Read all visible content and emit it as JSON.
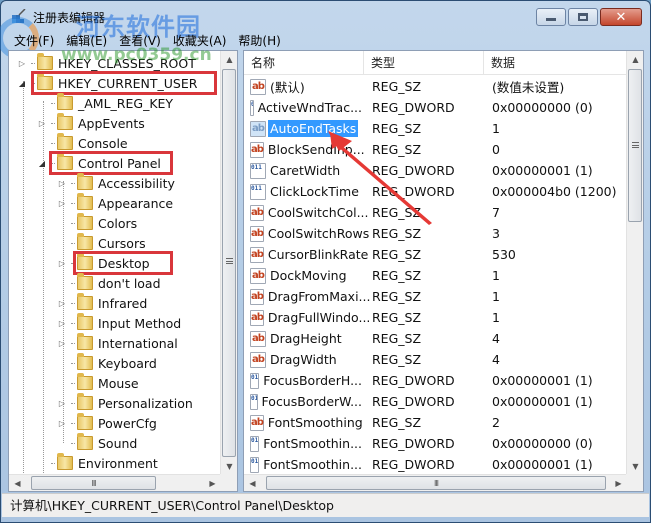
{
  "window": {
    "title": "注册表编辑器",
    "buttons": {
      "minimize": "minimize",
      "maximize": "maximize",
      "close": "✕"
    }
  },
  "watermark": {
    "text": "河东软件园",
    "url": "www.pc0359.cn"
  },
  "menu": [
    {
      "label": "文件(F)"
    },
    {
      "label": "编辑(E)"
    },
    {
      "label": "查看(V)"
    },
    {
      "label": "收藏夹(A)"
    },
    {
      "label": "帮助(H)"
    }
  ],
  "tree": {
    "items": [
      {
        "label": "HKEY_CLASSES_ROOT",
        "level": 0,
        "expander": "▷",
        "highlighted": false
      },
      {
        "label": "HKEY_CURRENT_USER",
        "level": 0,
        "expander": "◢",
        "highlighted": true
      },
      {
        "label": "_AML_REG_KEY",
        "level": 1,
        "expander": "",
        "highlighted": false
      },
      {
        "label": "AppEvents",
        "level": 1,
        "expander": "▷",
        "highlighted": false
      },
      {
        "label": "Console",
        "level": 1,
        "expander": "",
        "highlighted": false
      },
      {
        "label": "Control Panel",
        "level": 1,
        "expander": "◢",
        "highlighted": true
      },
      {
        "label": "Accessibility",
        "level": 2,
        "expander": "▷",
        "highlighted": false
      },
      {
        "label": "Appearance",
        "level": 2,
        "expander": "▷",
        "highlighted": false
      },
      {
        "label": "Colors",
        "level": 2,
        "expander": "",
        "highlighted": false
      },
      {
        "label": "Cursors",
        "level": 2,
        "expander": "",
        "highlighted": false
      },
      {
        "label": "Desktop",
        "level": 2,
        "expander": "▷",
        "highlighted": true,
        "selected": true
      },
      {
        "label": "don't load",
        "level": 2,
        "expander": "",
        "highlighted": false
      },
      {
        "label": "Infrared",
        "level": 2,
        "expander": "▷",
        "highlighted": false
      },
      {
        "label": "Input Method",
        "level": 2,
        "expander": "▷",
        "highlighted": false
      },
      {
        "label": "International",
        "level": 2,
        "expander": "▷",
        "highlighted": false
      },
      {
        "label": "Keyboard",
        "level": 2,
        "expander": "",
        "highlighted": false
      },
      {
        "label": "Mouse",
        "level": 2,
        "expander": "",
        "highlighted": false
      },
      {
        "label": "Personalization",
        "level": 2,
        "expander": "▷",
        "highlighted": false
      },
      {
        "label": "PowerCfg",
        "level": 2,
        "expander": "▷",
        "highlighted": false
      },
      {
        "label": "Sound",
        "level": 2,
        "expander": "",
        "highlighted": false
      },
      {
        "label": "Environment",
        "level": 1,
        "expander": "",
        "highlighted": false
      }
    ]
  },
  "list": {
    "headers": {
      "name": "名称",
      "type": "类型",
      "data": "数据"
    },
    "rows": [
      {
        "name": "(默认)",
        "type": "REG_SZ",
        "data": "(数值未设置)",
        "icon": "string-value-icon"
      },
      {
        "name": "ActiveWndTrac...",
        "type": "REG_DWORD",
        "data": "0x00000000 (0)",
        "icon": "dword-value-icon"
      },
      {
        "name": "AutoEndTasks",
        "type": "REG_SZ",
        "data": "1",
        "icon": "string-value-icon",
        "selected": true
      },
      {
        "name": "BlockSendInp...",
        "type": "REG_SZ",
        "data": "0",
        "icon": "string-value-icon"
      },
      {
        "name": "CaretWidth",
        "type": "REG_DWORD",
        "data": "0x00000001 (1)",
        "icon": "dword-value-icon"
      },
      {
        "name": "ClickLockTime",
        "type": "REG_DWORD",
        "data": "0x000004b0 (1200)",
        "icon": "dword-value-icon"
      },
      {
        "name": "CoolSwitchCol...",
        "type": "REG_SZ",
        "data": "7",
        "icon": "string-value-icon"
      },
      {
        "name": "CoolSwitchRows",
        "type": "REG_SZ",
        "data": "3",
        "icon": "string-value-icon"
      },
      {
        "name": "CursorBlinkRate",
        "type": "REG_SZ",
        "data": "530",
        "icon": "string-value-icon"
      },
      {
        "name": "DockMoving",
        "type": "REG_SZ",
        "data": "1",
        "icon": "string-value-icon"
      },
      {
        "name": "DragFromMaxi...",
        "type": "REG_SZ",
        "data": "1",
        "icon": "string-value-icon"
      },
      {
        "name": "DragFullWindo...",
        "type": "REG_SZ",
        "data": "1",
        "icon": "string-value-icon"
      },
      {
        "name": "DragHeight",
        "type": "REG_SZ",
        "data": "4",
        "icon": "string-value-icon"
      },
      {
        "name": "DragWidth",
        "type": "REG_SZ",
        "data": "4",
        "icon": "string-value-icon"
      },
      {
        "name": "FocusBorderH...",
        "type": "REG_DWORD",
        "data": "0x00000001 (1)",
        "icon": "dword-value-icon"
      },
      {
        "name": "FocusBorderW...",
        "type": "REG_DWORD",
        "data": "0x00000001 (1)",
        "icon": "dword-value-icon"
      },
      {
        "name": "FontSmoothing",
        "type": "REG_SZ",
        "data": "2",
        "icon": "string-value-icon"
      },
      {
        "name": "FontSmoothin...",
        "type": "REG_DWORD",
        "data": "0x00000000 (0)",
        "icon": "dword-value-icon"
      },
      {
        "name": "FontSmoothin...",
        "type": "REG_DWORD",
        "data": "0x00000001 (1)",
        "icon": "dword-value-icon"
      }
    ]
  },
  "icons": {
    "string_glyph": "ab",
    "dword_glyph": "011 110",
    "scroll_up": "▲",
    "scroll_down": "▼",
    "scroll_left": "◀",
    "scroll_right": "▶",
    "grip": "III"
  },
  "statusbar": {
    "path": "计算机\\HKEY_CURRENT_USER\\Control Panel\\Desktop"
  },
  "colors": {
    "selection": "#3399ff",
    "annotation": "#d9363b",
    "close_button": "#c4462c"
  }
}
